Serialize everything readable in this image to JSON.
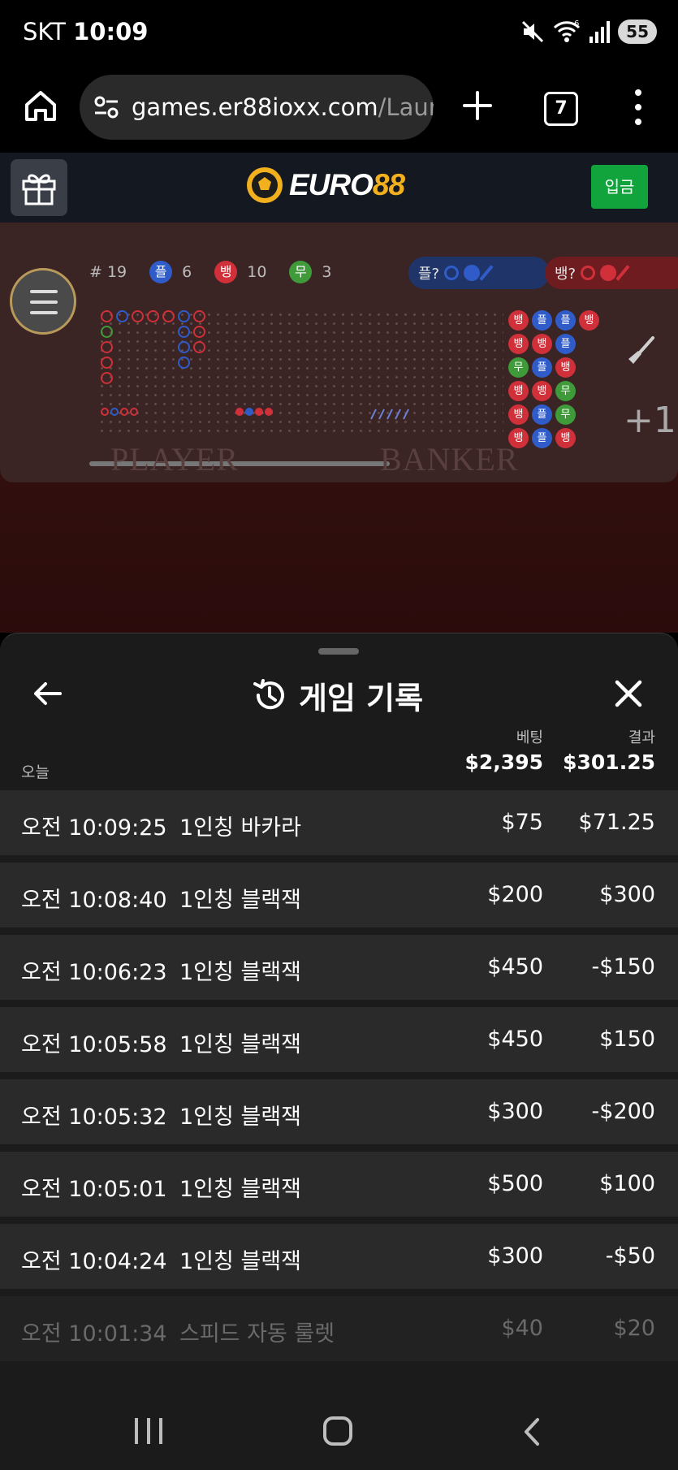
{
  "status_bar": {
    "carrier": "SKT",
    "time": "10:09",
    "wifi_badge": "6",
    "battery": "55"
  },
  "browser": {
    "url_main": "games.er88ioxx.com",
    "url_path": "/Launc",
    "tab_count": "7"
  },
  "site": {
    "logo_word": "EURO",
    "logo_num": "88",
    "deposit_label": "입금",
    "brand_color": "#f2b01e",
    "deposit_color": "#11a33c"
  },
  "game": {
    "round_label": "# 19",
    "player_badge": "플",
    "player_count": "6",
    "banker_badge": "뱅",
    "banker_count": "10",
    "tie_badge": "무",
    "tie_count": "3",
    "player_predict_label": "플?",
    "banker_predict_label": "뱅?",
    "watermark_player": "PLAYER",
    "watermark_banker": "BANKER",
    "plus_one": "+1",
    "bead_road": [
      [
        "뱅",
        "플",
        "플",
        "뱅"
      ],
      [
        "뱅",
        "뱅",
        "플"
      ],
      [
        "무",
        "플",
        "뱅"
      ],
      [
        "뱅",
        "뱅",
        "무"
      ],
      [
        "뱅",
        "플",
        "무"
      ],
      [
        "뱅",
        "플",
        "뱅"
      ]
    ],
    "colors": {
      "player": "#2f5cc9",
      "banker": "#d0303a",
      "tie": "#3f9a3a"
    }
  },
  "history": {
    "title": "게임 기록",
    "col_bet": "베팅",
    "col_result": "결과",
    "date_label": "오늘",
    "total_bet": "$2,395",
    "total_result": "$301.25",
    "rows": [
      {
        "time": "오전 10:09:25",
        "game": "1인칭 바카라",
        "bet": "$75",
        "result": "$71.25"
      },
      {
        "time": "오전 10:08:40",
        "game": "1인칭 블랙잭",
        "bet": "$200",
        "result": "$300"
      },
      {
        "time": "오전 10:06:23",
        "game": "1인칭 블랙잭",
        "bet": "$450",
        "result": "-$150"
      },
      {
        "time": "오전 10:05:58",
        "game": "1인칭 블랙잭",
        "bet": "$450",
        "result": "$150"
      },
      {
        "time": "오전 10:05:32",
        "game": "1인칭 블랙잭",
        "bet": "$300",
        "result": "-$200"
      },
      {
        "time": "오전 10:05:01",
        "game": "1인칭 블랙잭",
        "bet": "$500",
        "result": "$100"
      },
      {
        "time": "오전 10:04:24",
        "game": "1인칭 블랙잭",
        "bet": "$300",
        "result": "-$50"
      },
      {
        "time": "오전 10:01:34",
        "game": "스피드 자동 룰렛",
        "bet": "$40",
        "result": "$20"
      }
    ]
  }
}
